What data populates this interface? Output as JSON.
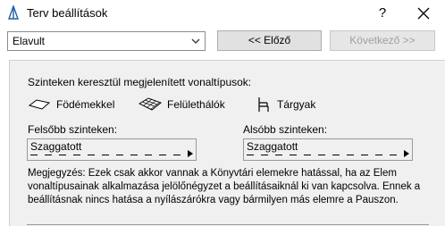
{
  "window": {
    "title": "Terv beállítások",
    "help_label": "?",
    "close_icon": "close-icon"
  },
  "toolbar": {
    "dropdown_value": "Elavult",
    "prev_label": "<< Előző",
    "next_label": "Következő >>"
  },
  "panel": {
    "heading": "Szinteken keresztül megjelenített vonaltípusok:",
    "options": [
      {
        "label": "Födémekkel",
        "icon": "slab-icon"
      },
      {
        "label": "Felülethálók",
        "icon": "mesh-icon"
      },
      {
        "label": "Tárgyak",
        "icon": "object-icon"
      }
    ],
    "upper_label": "Felsőbb szinteken:",
    "lower_label": "Alsóbb szinteken:",
    "upper_linetype": "Szaggatott",
    "lower_linetype": "Szaggatott",
    "note": "Megjegyzés: Ezek csak akkor vannak a Könyvtári elemekre hatással, ha az Elem vonaltípusainak alkalmazása jelölőnégyzet a beállításaiknál ki van kapcsolva. Ennek a beállításnak nincs hatása a nyílászárókra vagy bármilyen más elemre a Pauszon."
  }
}
